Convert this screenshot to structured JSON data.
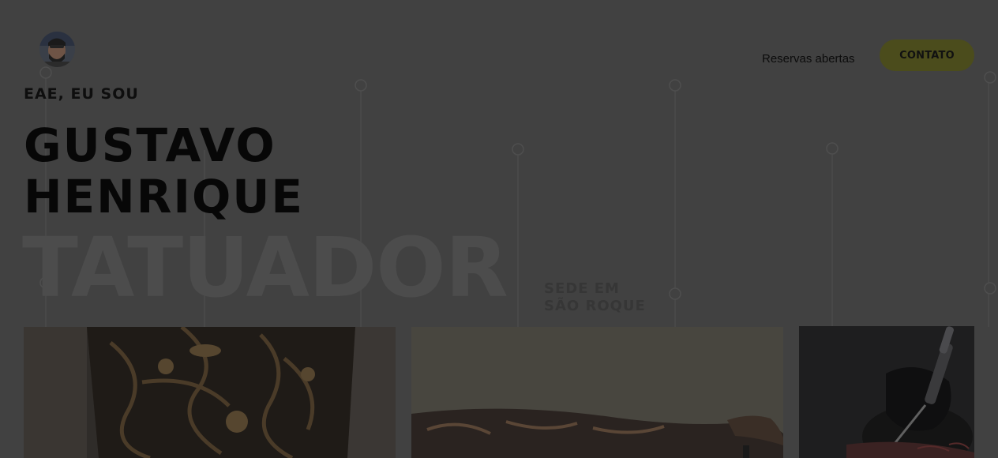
{
  "header": {
    "avatar_icon": "tattoo-artist-avatar",
    "status_text": "Reservas abertas",
    "contact_label": "CONTATO"
  },
  "hero": {
    "eyebrow": "EAE, EU SOU",
    "name_line1": "GUSTAVO",
    "name_line2": "HENRIQUE",
    "role": "TATUADOR",
    "location_line1": "SEDE EM",
    "location_line2": "SÃO ROQUE"
  },
  "gallery": {
    "photos": [
      "tattoo-sleeve-photo",
      "tattooed-arm-photo",
      "tattooing-process-photo"
    ]
  },
  "colors": {
    "overlay_bg": "#414141",
    "button_bg": "#4b4c1c",
    "text_dark": "#0c0c0c"
  }
}
